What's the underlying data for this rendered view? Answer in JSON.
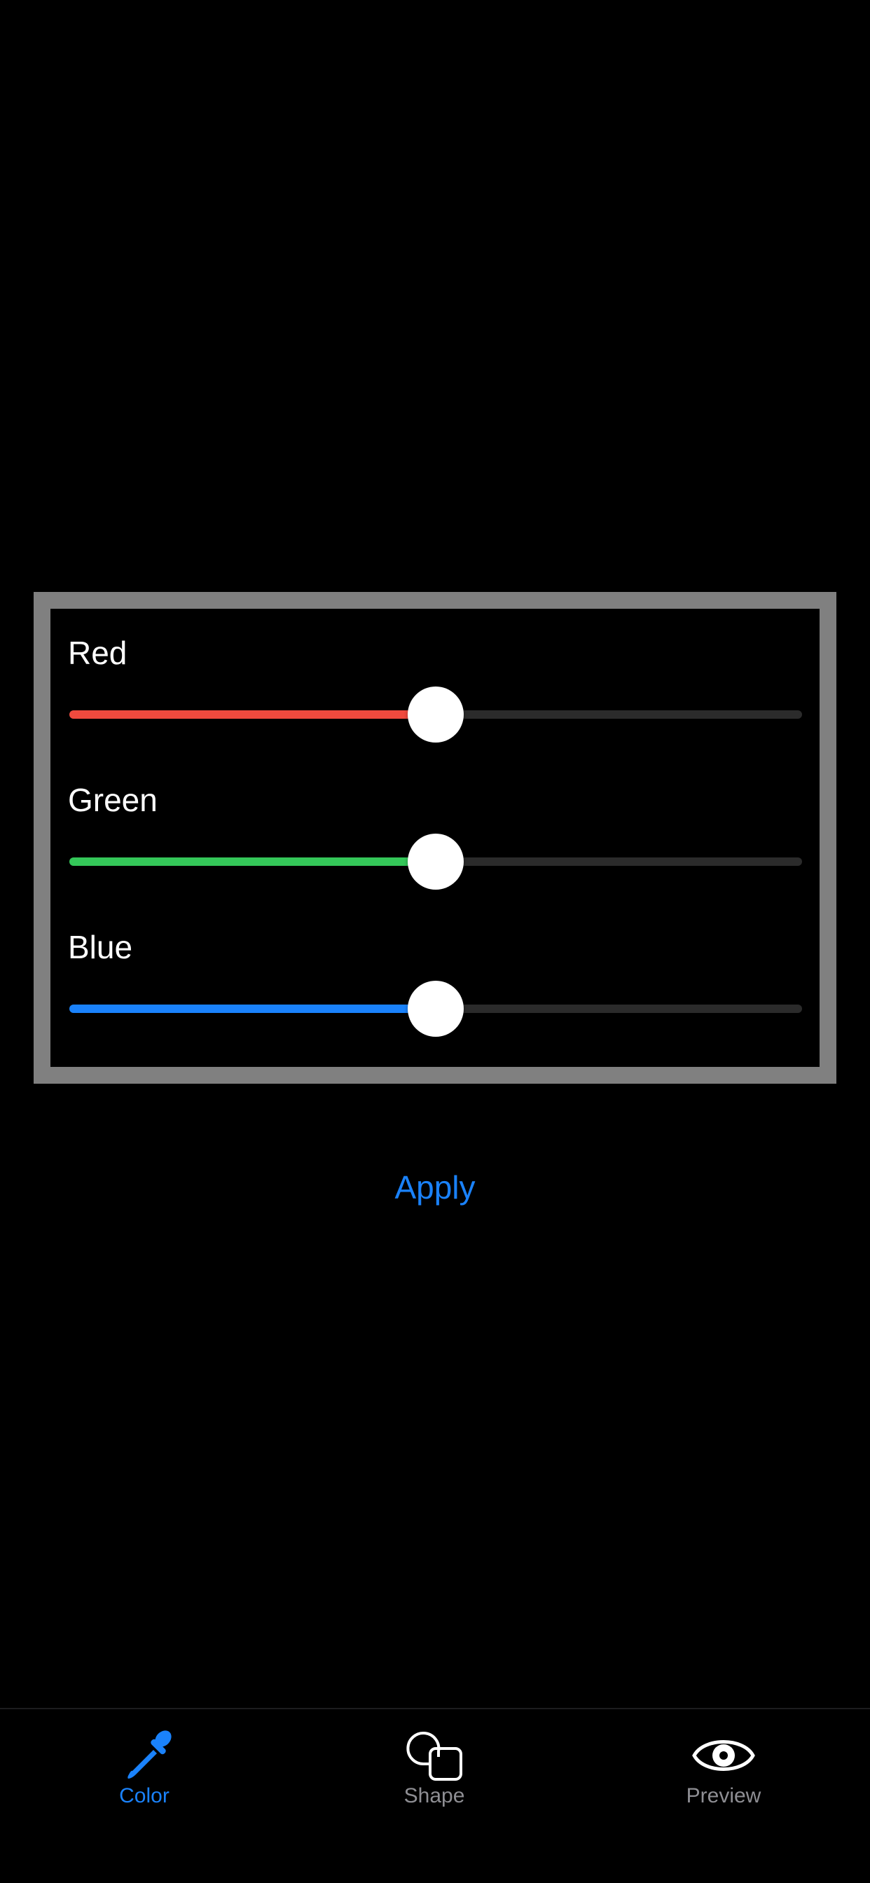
{
  "colors": {
    "background": "#000000",
    "panel_border": "#808080",
    "track_inactive": "#2b2b2b",
    "accent": "#1a82fb",
    "tab_inactive": "#8e8e93"
  },
  "sliders": [
    {
      "label": "Red",
      "value": 0.5,
      "color": "#f04a3e"
    },
    {
      "label": "Green",
      "value": 0.5,
      "color": "#34c759"
    },
    {
      "label": "Blue",
      "value": 0.5,
      "color": "#1a82fb"
    }
  ],
  "apply_label": "Apply",
  "tab_bar": {
    "selected": "color",
    "tabs": [
      {
        "id": "color",
        "label": "Color",
        "icon": "eyedropper-icon"
      },
      {
        "id": "shape",
        "label": "Shape",
        "icon": "shapes-icon"
      },
      {
        "id": "preview",
        "label": "Preview",
        "icon": "eye-icon"
      }
    ]
  }
}
